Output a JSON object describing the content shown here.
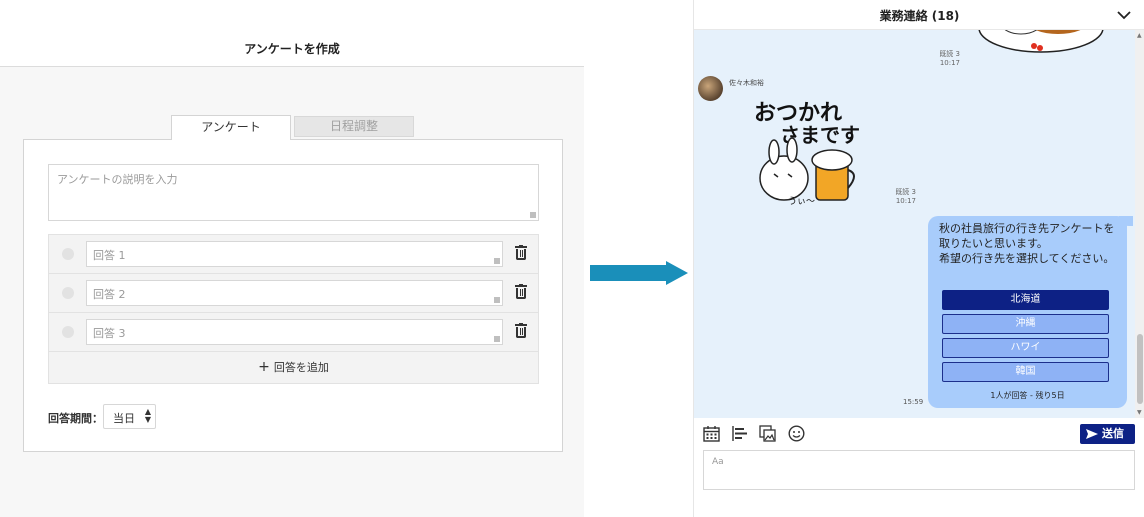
{
  "survey_editor": {
    "title": "アンケートを作成",
    "tabs": [
      {
        "label": "アンケート",
        "active": true
      },
      {
        "label": "日程調整",
        "active": false
      }
    ],
    "description_placeholder": "アンケートの説明を入力",
    "answers": [
      {
        "placeholder": "回答 1"
      },
      {
        "placeholder": "回答 2"
      },
      {
        "placeholder": "回答 3"
      }
    ],
    "add_answer_icon": "+",
    "add_answer_label": "回答を追加",
    "period_label": "回答期間：",
    "period_value": "当日",
    "period_arrow": "▲▼"
  },
  "chat": {
    "title": "業務連絡 (18)",
    "top_read": "既読 3",
    "top_time": "10:17",
    "sender_name": "佐々木和裕",
    "sticker_read": "既読 3",
    "sticker_time": "10:17",
    "message": "秋の社員旅行の行き先アンケートを取りたいと思います。\n希望の行き先を選択してください。",
    "options": [
      {
        "label": "北海道",
        "selected": true
      },
      {
        "label": "沖縄",
        "selected": false
      },
      {
        "label": "ハワイ",
        "selected": false
      },
      {
        "label": "韓国",
        "selected": false
      }
    ],
    "poll_status": "1人が回答 - 残り5日",
    "sent_time": "15:59",
    "send_label": "送信",
    "input_placeholder": "Aa",
    "scroll_up": "▲",
    "scroll_down": "▼",
    "sticker_text_line1": "おつかれ",
    "sticker_text_line2": "さまです",
    "sticker_caption": "うぃ〜"
  },
  "colors": {
    "accent_dark_blue": "#0d2185",
    "bubble_blue": "#a8ccfb",
    "arrow_teal": "#1a8fba",
    "chat_bg": "#e6f1fb"
  },
  "icons": [
    "chevron-down-icon",
    "calendar-icon",
    "align-left-icon",
    "image-icon",
    "smiley-icon",
    "send-plane-icon",
    "trash-icon",
    "plus-icon"
  ]
}
